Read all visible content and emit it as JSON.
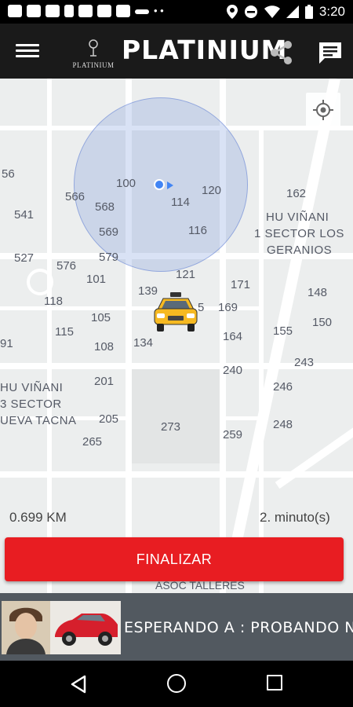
{
  "status_bar": {
    "time": "3:20",
    "icons": [
      "news-icon",
      "image-icon",
      "youtube-icon",
      "phone-icon",
      "scan-icon",
      "mail-icon",
      "gallery-icon",
      "brand-icon",
      "more-dots-icon",
      "location-icon",
      "dnd-icon",
      "wifi-icon",
      "battery-icon"
    ],
    "dots": "• •"
  },
  "app_bar": {
    "logo_text": "PLATINIUM",
    "title": "PLATINIUM"
  },
  "map": {
    "labels": [
      {
        "text": "56"
      },
      {
        "text": "566"
      },
      {
        "text": "100"
      },
      {
        "text": "120"
      },
      {
        "text": "162"
      },
      {
        "text": "541"
      },
      {
        "text": "568"
      },
      {
        "text": "114"
      },
      {
        "text": "569"
      },
      {
        "text": "116"
      },
      {
        "text": "527"
      },
      {
        "text": "579"
      },
      {
        "text": "576"
      },
      {
        "text": "121"
      },
      {
        "text": "101"
      },
      {
        "text": "139"
      },
      {
        "text": "171"
      },
      {
        "text": "148"
      },
      {
        "text": "118"
      },
      {
        "text": "5"
      },
      {
        "text": "169"
      },
      {
        "text": "105"
      },
      {
        "text": "150"
      },
      {
        "text": "115"
      },
      {
        "text": "155"
      },
      {
        "text": "164"
      },
      {
        "text": "91"
      },
      {
        "text": "108"
      },
      {
        "text": "134"
      },
      {
        "text": "243"
      },
      {
        "text": "240"
      },
      {
        "text": "201"
      },
      {
        "text": "246"
      },
      {
        "text": "205"
      },
      {
        "text": "248"
      },
      {
        "text": "273"
      },
      {
        "text": "259"
      },
      {
        "text": "265"
      }
    ],
    "area_labels": {
      "hu_vinani_1": "HU VIÑANI",
      "sector_1": "1 SECTOR LOS",
      "geranios": "GERANIOS",
      "hu_vinani_3": "HU VIÑANI",
      "sector_3": "3 SECTOR",
      "nueva_tacna": "UEVA TACNA",
      "asoc": "ASOC TALLERES"
    }
  },
  "trip": {
    "distance": "0.699 KM",
    "eta": "2. minuto(s)"
  },
  "action": {
    "finalize_label": "FINALIZAR"
  },
  "waiting": {
    "text": "ESPERANDO A : PROBANDO N"
  },
  "colors": {
    "primary_red": "#e81d22",
    "app_bar": "#1a1a1a",
    "wait_bar": "#525960",
    "location_blue": "#4285f4"
  }
}
